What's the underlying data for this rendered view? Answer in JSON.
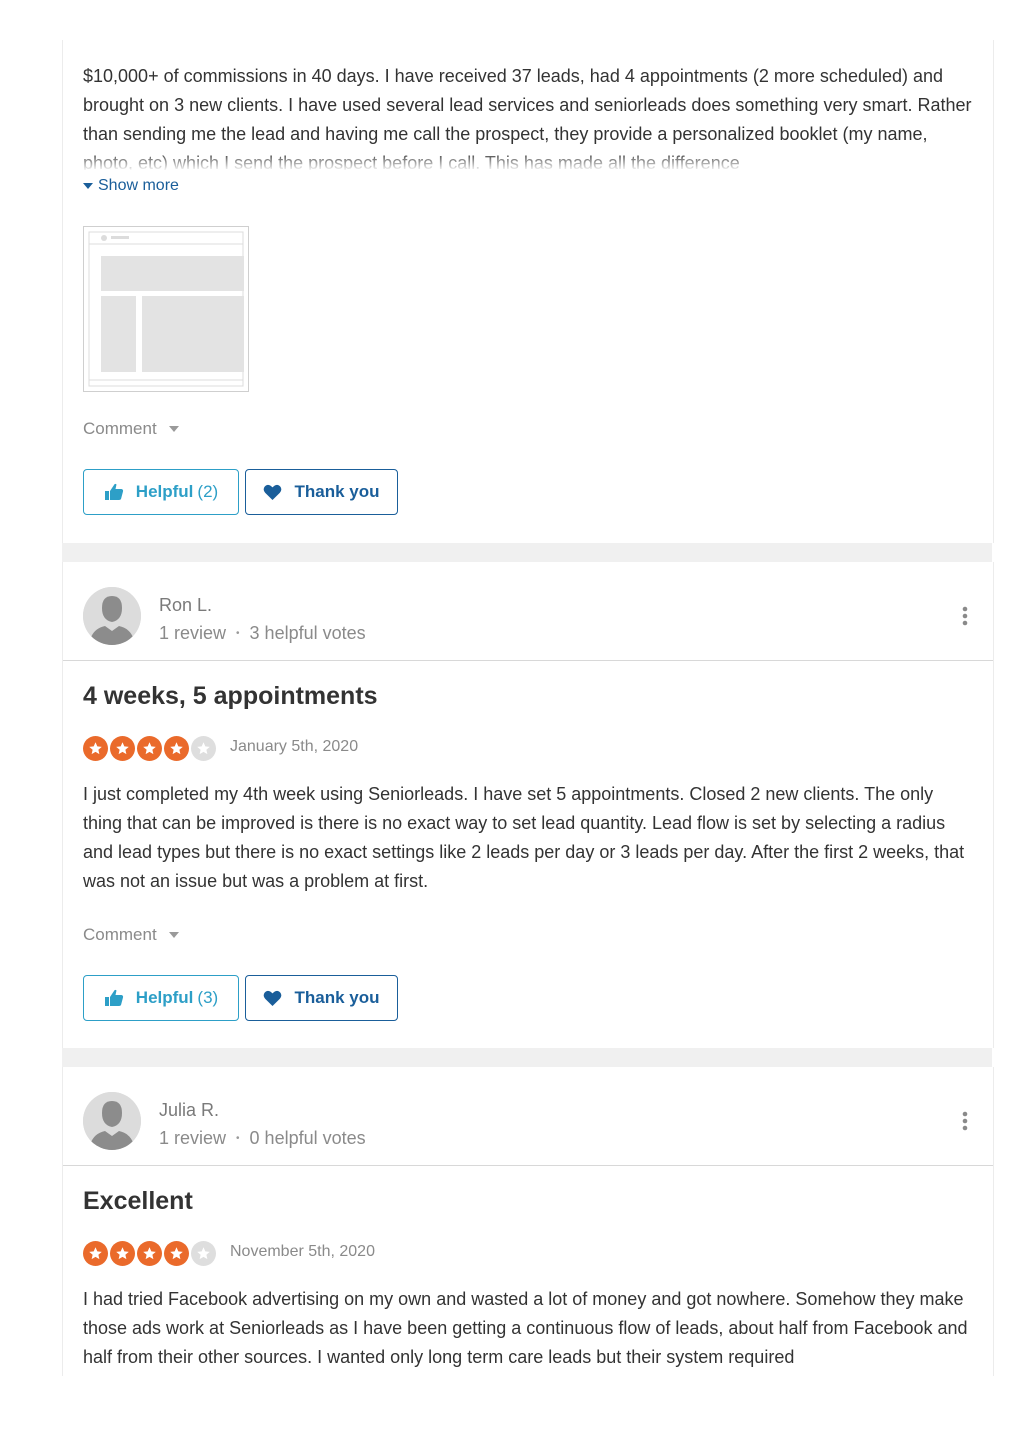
{
  "review1": {
    "text": "$10,000+ of commissions in 40 days. I have received 37 leads, had 4 appointments (2 more scheduled) and brought on 3 new clients. I have used several lead services and seniorleads does something very smart. Rather than sending me the lead and having me call the prospect, they provide a personalized booklet (my name, photo, etc) which I send the prospect before I call. This has made all the difference",
    "show_more": "Show more",
    "comment": "Comment",
    "helpful_label": "Helpful",
    "helpful_count": "(2)",
    "thanks_label": "Thank you"
  },
  "review2": {
    "author": "Ron L.",
    "reviews": "1 review",
    "votes": "3 helpful votes",
    "title": "4 weeks, 5 appointments",
    "rating": 4,
    "date": "January 5th, 2020",
    "text": "I just completed my 4th week using Seniorleads. I have set 5 appointments. Closed 2 new clients. The only thing that can be improved is there is no exact way to set lead quantity. Lead flow is set by selecting a radius and lead types but there is no exact settings like 2 leads per day or 3 leads per day. After the first 2 weeks, that was not an issue but was a problem at first.",
    "comment": "Comment",
    "helpful_label": "Helpful",
    "helpful_count": "(3)",
    "thanks_label": "Thank you"
  },
  "review3": {
    "author": "Julia R.",
    "reviews": "1 review",
    "votes": "0 helpful votes",
    "title": "Excellent",
    "rating": 4,
    "date": "November 5th, 2020",
    "text": "I had tried Facebook advertising on my own and wasted a lot of money and got nowhere. Somehow they make those ads work at Seniorleads as I have been getting a continuous flow of leads, about half from Facebook and half from their other sources. I wanted only long term care leads but their system required"
  },
  "colors": {
    "star_on": "#ea6a2b",
    "star_off": "#dedede",
    "helpful": "#2d9fc7",
    "thanks": "#1a5e9a"
  },
  "icons": {
    "thumbs_up": "thumbs-up-icon",
    "heart": "heart-icon",
    "kebab": "more-vertical-icon",
    "avatar": "user-silhouette-icon"
  }
}
